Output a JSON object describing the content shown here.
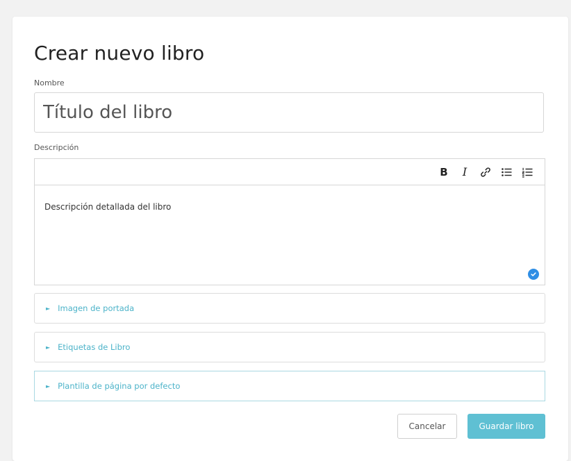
{
  "form": {
    "title": "Crear nuevo libro",
    "name_label": "Nombre",
    "name_placeholder": "Título del libro",
    "description_label": "Descripción",
    "description_text": "Descripción detallada del libro"
  },
  "toolbar": {
    "bold": "B",
    "italic": "I",
    "icons": [
      "link-icon",
      "bullet-list-icon",
      "numbered-list-icon"
    ]
  },
  "sections": [
    {
      "label": "Imagen de portada"
    },
    {
      "label": "Etiquetas de Libro"
    },
    {
      "label": "Plantilla de página por defecto"
    }
  ],
  "buttons": {
    "cancel": "Cancelar",
    "save": "Guardar libro"
  },
  "colors": {
    "accent": "#5fc0d3",
    "link": "#4cb3c9",
    "check": "#2f8ee5"
  }
}
